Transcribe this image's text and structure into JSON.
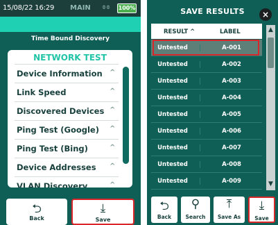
{
  "left": {
    "status": {
      "time": "15/08/22 16:29",
      "mode": "MAIN",
      "connection": "⌽⌽",
      "battery": "100%"
    },
    "subtitle": "Time Bound Discovery",
    "heading": "NETWORK TEST",
    "items": [
      {
        "label": "Device Information"
      },
      {
        "label": "Link Speed"
      },
      {
        "label": "Discovered Devices"
      },
      {
        "label": "Ping Test (Google)"
      },
      {
        "label": "Ping Test (Bing)"
      },
      {
        "label": "Device Addresses"
      },
      {
        "label": "VLAN Discovery"
      }
    ],
    "buttons": {
      "back": "Back",
      "save": "Save"
    }
  },
  "right": {
    "title": "SAVE RESULTS",
    "close_icon": "×",
    "columns": {
      "result": "RESULT ^",
      "label": "LABEL"
    },
    "rows": [
      {
        "result": "Untested",
        "label": "A-001"
      },
      {
        "result": "Untested",
        "label": "A-002"
      },
      {
        "result": "Untested",
        "label": "A-003"
      },
      {
        "result": "Untested",
        "label": "A-004"
      },
      {
        "result": "Untested",
        "label": "A-005"
      },
      {
        "result": "Untested",
        "label": "A-006"
      },
      {
        "result": "Untested",
        "label": "A-007"
      },
      {
        "result": "Untested",
        "label": "A-008"
      },
      {
        "result": "Untested",
        "label": "A-009"
      }
    ],
    "selected_row": 0,
    "buttons": {
      "back": "Back",
      "search": "Search",
      "save_as": "Save As",
      "save": "Save"
    }
  },
  "icons": {
    "back": "back-arrow-icon",
    "save": "download-icon",
    "search": "magnifier-icon",
    "save_as": "upload-icon",
    "chevron": "chevron-up-icon"
  },
  "colors": {
    "accent": "#1fd0b3",
    "panel": "#0f5f56",
    "highlight": "#d8262b"
  }
}
